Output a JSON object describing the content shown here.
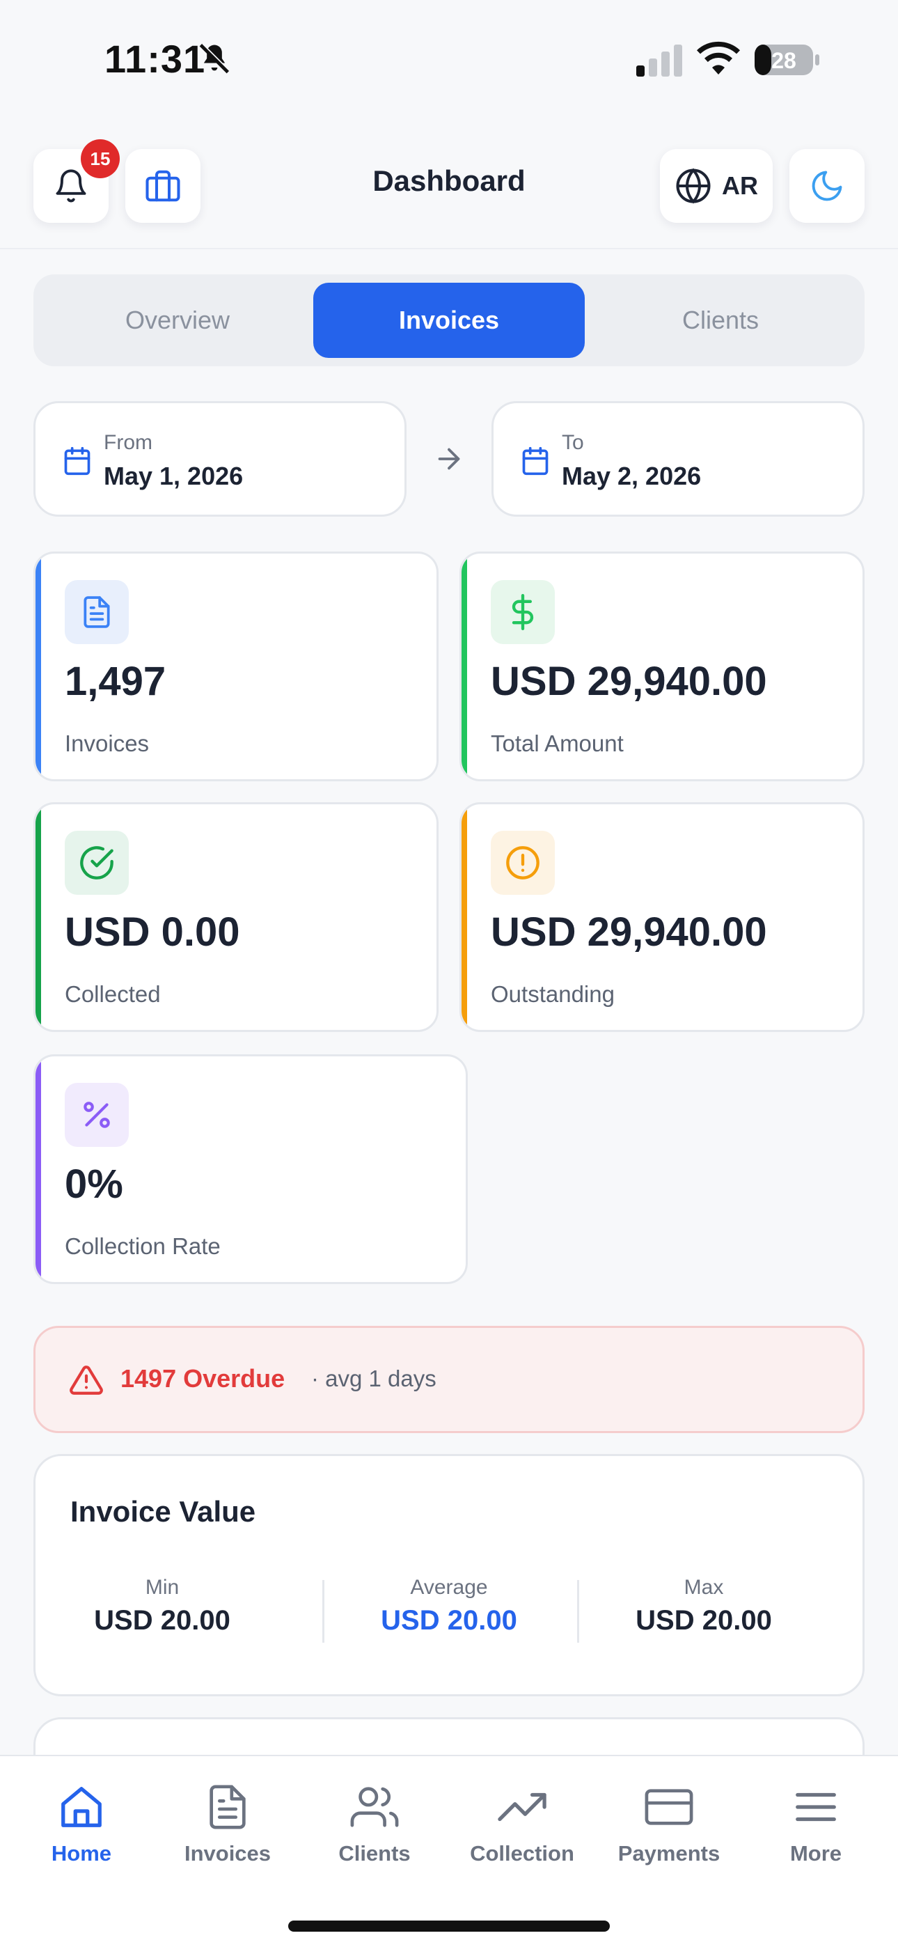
{
  "status_bar": {
    "time": "11:31",
    "battery": "28"
  },
  "header": {
    "title": "Dashboard",
    "notification_count": "15",
    "language_label": "AR"
  },
  "tabs": [
    {
      "label": "Overview",
      "active": false
    },
    {
      "label": "Invoices",
      "active": true
    },
    {
      "label": "Clients",
      "active": false
    }
  ],
  "date_range": {
    "from_label": "From",
    "from_value": "May 1, 2026",
    "to_label": "To",
    "to_value": "May 2, 2026"
  },
  "stats": [
    {
      "value": "1,497",
      "label": "Invoices",
      "icon": "document-icon",
      "color": "#3b82f6"
    },
    {
      "value": "USD 29,940.00",
      "label": "Total Amount",
      "icon": "dollar-icon",
      "color": "#22c55e"
    },
    {
      "value": "USD 0.00",
      "label": "Collected",
      "icon": "check-circle-icon",
      "color": "#16a34a"
    },
    {
      "value": "USD 29,940.00",
      "label": "Outstanding",
      "icon": "alert-circle-icon",
      "color": "#f59e0b"
    },
    {
      "value": "0%",
      "label": "Collection Rate",
      "icon": "percent-icon",
      "color": "#8b5cf6"
    }
  ],
  "overdue": {
    "count_text": "1497 Overdue",
    "avg_text": "· avg 1 days"
  },
  "invoice_value": {
    "title": "Invoice Value",
    "min_label": "Min",
    "min_value": "USD 20.00",
    "avg_label": "Average",
    "avg_value": "USD 20.00",
    "max_label": "Max",
    "max_value": "USD 20.00"
  },
  "bottom_nav": [
    {
      "label": "Home",
      "icon": "home-icon",
      "active": true
    },
    {
      "label": "Invoices",
      "icon": "document-icon",
      "active": false
    },
    {
      "label": "Clients",
      "icon": "users-icon",
      "active": false
    },
    {
      "label": "Collection",
      "icon": "trending-up-icon",
      "active": false
    },
    {
      "label": "Payments",
      "icon": "credit-card-icon",
      "active": false
    },
    {
      "label": "More",
      "icon": "menu-icon",
      "active": false
    }
  ],
  "colors": {
    "primary": "#2563eb",
    "danger": "#e23b3b",
    "background": "#f7f8fa"
  }
}
